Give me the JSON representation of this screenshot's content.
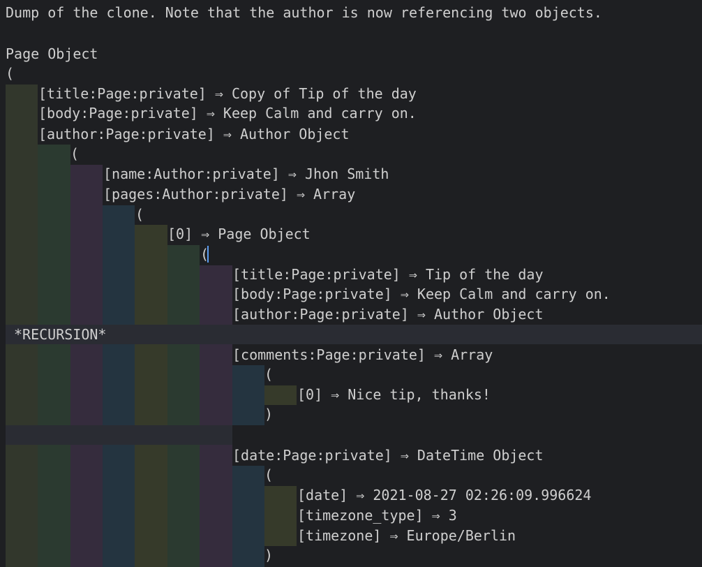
{
  "colors": {
    "background": "#1e1f22",
    "text": "#cfcfcf",
    "band_olive": "#32372c",
    "band_green": "#2b3a30",
    "band_purple": "#352c3d",
    "band_teal": "#243440",
    "band_darkolive": "#363a2a",
    "separator": "#2a2c33",
    "cursor": "#5b9cf0"
  },
  "lines": [
    {
      "text": "Dump of the clone. Note that the author is now referencing two objects."
    },
    {
      "text": "Page Object"
    },
    {
      "text": "("
    },
    {
      "text": "[title:Page:private] ⇒ Copy of Tip of the day"
    },
    {
      "text": "[body:Page:private] ⇒ Keep Calm and carry on."
    },
    {
      "text": "[author:Page:private] ⇒ Author Object"
    },
    {
      "text": "("
    },
    {
      "text": "[name:Author:private] ⇒ Jhon Smith"
    },
    {
      "text": "[pages:Author:private] ⇒ Array"
    },
    {
      "text": "("
    },
    {
      "text": "[0] ⇒ Page Object"
    },
    {
      "text": "("
    },
    {
      "text": "[title:Page:private] ⇒ Tip of the day"
    },
    {
      "text": "[body:Page:private] ⇒ Keep Calm and carry on."
    },
    {
      "text": "[author:Page:private] ⇒ Author Object"
    },
    {
      "text": "*RECURSION*"
    },
    {
      "text": "[comments:Page:private] ⇒ Array"
    },
    {
      "text": "("
    },
    {
      "text": "[0] ⇒ Nice tip, thanks!"
    },
    {
      "text": ")"
    },
    {
      "text": "[date:Page:private] ⇒ DateTime Object"
    },
    {
      "text": "("
    },
    {
      "text": "[date] ⇒ 2021-08-27 02:26:09.996624"
    },
    {
      "text": "[timezone_type] ⇒ 3"
    },
    {
      "text": "[timezone] ⇒ Europe/Berlin"
    },
    {
      "text": ")"
    }
  ]
}
